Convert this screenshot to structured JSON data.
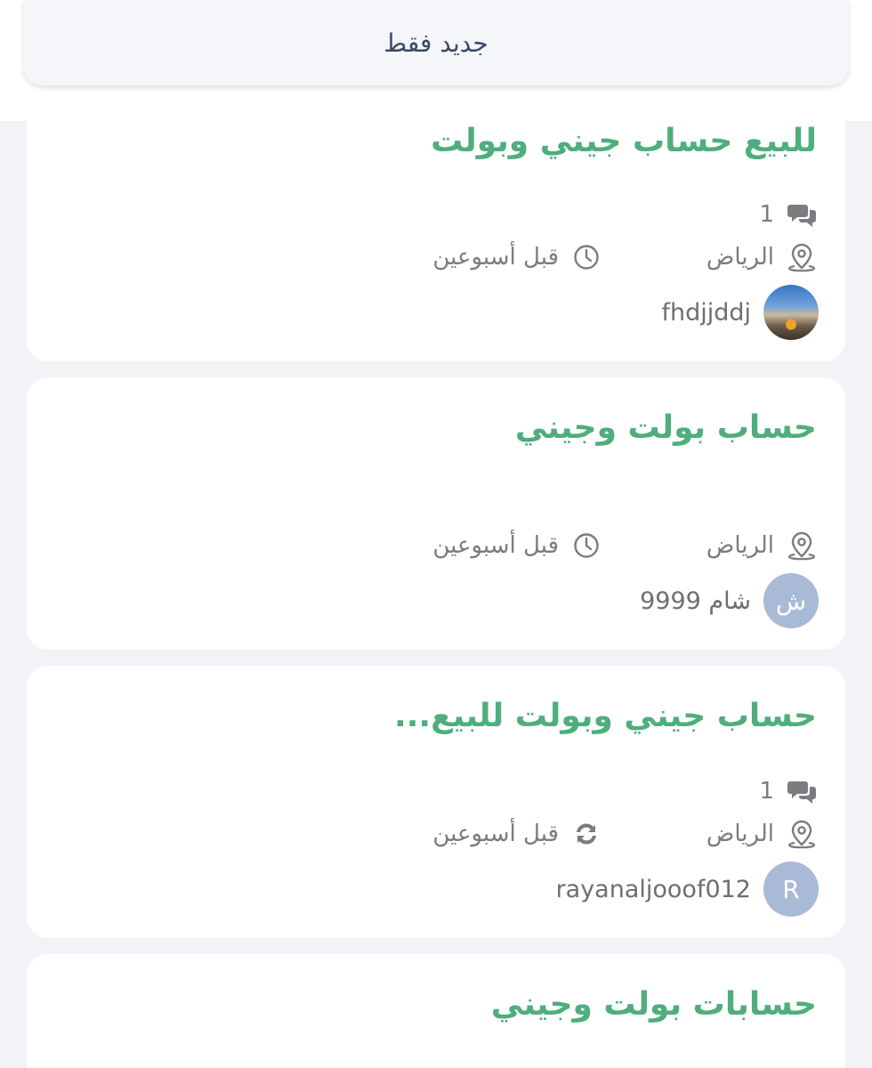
{
  "header": {
    "filter_label": "جديد فقط"
  },
  "posts": [
    {
      "title": "للبيع حساب جيني وبولت",
      "comments": "1",
      "location": "الرياض",
      "time": "قبل أسبوعين",
      "time_icon": "clock-icon",
      "username": "fhdjjddj",
      "avatar_letter": ""
    },
    {
      "title": "حساب بولت وجيني",
      "location": "الرياض",
      "time": "قبل أسبوعين",
      "time_icon": "clock-icon",
      "username": "شام 9999",
      "avatar_letter": "ش"
    },
    {
      "title": "حساب جيني وبولت للبيع...",
      "comments": "1",
      "location": "الرياض",
      "time": "قبل أسبوعين",
      "time_icon": "refresh-icon",
      "username": "rayanaljooof012",
      "avatar_letter": "R"
    },
    {
      "title": "حسابات بولت وجيني"
    }
  ],
  "colors": {
    "title_green": "#4fae7c",
    "meta_gray": "#7b7b80",
    "avatar_blue": "#a9bad6",
    "background": "#f2f2f7"
  }
}
